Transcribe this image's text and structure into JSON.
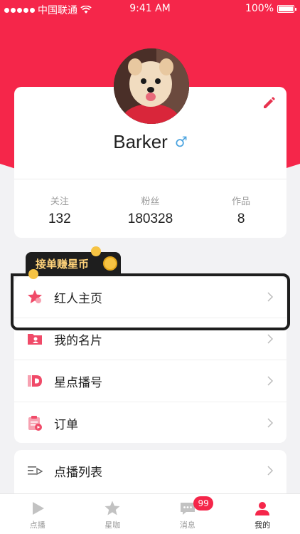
{
  "status_bar": {
    "carrier": "中国联通",
    "time": "9:41 AM",
    "battery": "100%"
  },
  "profile": {
    "username": "Barker",
    "gender_symbol": "♂"
  },
  "stats": [
    {
      "label": "关注",
      "value": "132"
    },
    {
      "label": "粉丝",
      "value": "180328"
    },
    {
      "label": "作品",
      "value": "8"
    }
  ],
  "promo": {
    "label": "接单赚星币"
  },
  "menu": [
    {
      "label": "红人主页",
      "icon": "star-icon"
    },
    {
      "label": "我的名片",
      "icon": "folder-user-icon"
    },
    {
      "label": "星点播号",
      "icon": "d-logo-icon"
    },
    {
      "label": "订单",
      "icon": "order-icon"
    }
  ],
  "menu2": [
    {
      "label": "点播列表",
      "icon": "list-play-icon"
    }
  ],
  "tabs": [
    {
      "label": "点播",
      "icon": "play-icon"
    },
    {
      "label": "星咖",
      "icon": "star-icon"
    },
    {
      "label": "消息",
      "icon": "chat-icon",
      "badge": "99"
    },
    {
      "label": "我的",
      "icon": "person-icon"
    }
  ],
  "colors": {
    "brand": "#f5264a",
    "gold": "#ffd37a"
  }
}
